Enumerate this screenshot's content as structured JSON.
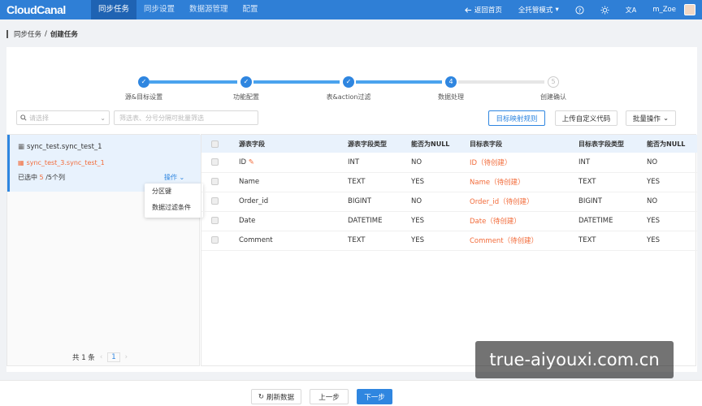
{
  "app": {
    "logo": "CloudCanal",
    "nav": [
      "同步任务",
      "同步设置",
      "数据源管理",
      "配置"
    ],
    "back_home": "返回首页",
    "mode": "全托管模式",
    "user": "m_Zoe"
  },
  "breadcrumb": [
    "同步任务",
    "/",
    "创建任务"
  ],
  "steps": [
    {
      "label": "源&目标设置",
      "state": "done"
    },
    {
      "label": "功能配置",
      "state": "done"
    },
    {
      "label": "表&action过滤",
      "state": "done"
    },
    {
      "label": "数据处理",
      "state": "active",
      "num": "4"
    },
    {
      "label": "创建确认",
      "state": "pending",
      "num": "5"
    }
  ],
  "filter": {
    "select_placeholder": "请选择",
    "search_placeholder": "筛选表、分号分隔可批量筛选"
  },
  "buttons": {
    "mapping_rules": "目标映射规则",
    "upload_code": "上传自定义代码",
    "batch_ops": "批量操作"
  },
  "left": {
    "source_table": "sync_test.sync_test_1",
    "target_table": "sync_test_3.sync_test_1",
    "selected_prefix": "已选中",
    "selected_num": "5",
    "selected_suffix": "/5个列",
    "op_label": "操作",
    "dropdown": [
      "分区键",
      "数据过滤条件"
    ],
    "pager_total": "共 1 条",
    "pager_page": "1"
  },
  "table": {
    "headers": [
      "源表字段",
      "源表字段类型",
      "能否为NULL",
      "目标表字段",
      "目标表字段类型",
      "能否为NULL"
    ],
    "rows": [
      {
        "src": "ID",
        "src_type": "INT",
        "src_null": "NO",
        "tgt": "ID（待创建）",
        "tgt_type": "INT",
        "tgt_null": "NO"
      },
      {
        "src": "Name",
        "src_type": "TEXT",
        "src_null": "YES",
        "tgt": "Name（待创建）",
        "tgt_type": "TEXT",
        "tgt_null": "YES"
      },
      {
        "src": "Order_id",
        "src_type": "BIGINT",
        "src_null": "NO",
        "tgt": "Order_id（待创建）",
        "tgt_type": "BIGINT",
        "tgt_null": "NO"
      },
      {
        "src": "Date",
        "src_type": "DATETIME",
        "src_null": "YES",
        "tgt": "Date（待创建）",
        "tgt_type": "DATETIME",
        "tgt_null": "YES"
      },
      {
        "src": "Comment",
        "src_type": "TEXT",
        "src_null": "YES",
        "tgt": "Comment（待创建）",
        "tgt_type": "TEXT",
        "tgt_null": "YES"
      }
    ]
  },
  "footer": {
    "refresh": "刷新数据",
    "prev": "上一步",
    "next": "下一步"
  },
  "watermark": "true-aiyouxi.com.cn",
  "colors": {
    "brand": "#2f7fd6",
    "accent": "#2f86e0",
    "target_text": "#f26b3a"
  }
}
